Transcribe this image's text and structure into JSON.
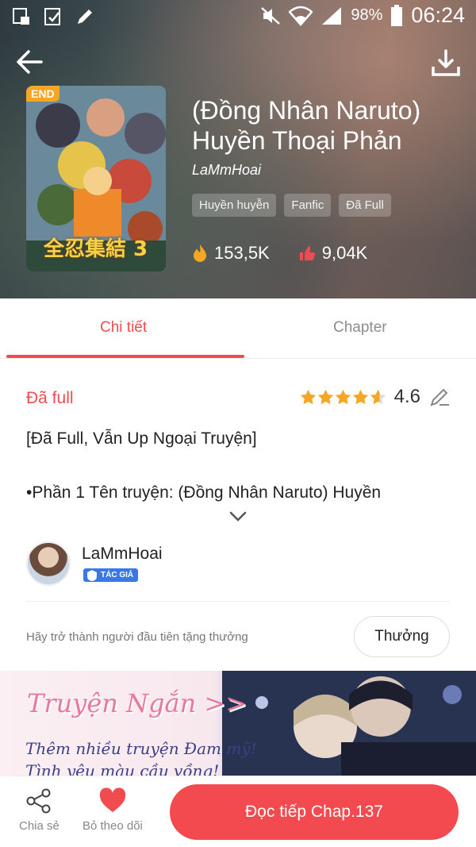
{
  "status_bar": {
    "battery": "98%",
    "time": "06:24"
  },
  "book": {
    "badge": "END",
    "cover_text": "全忍集結 3",
    "title": "(Đồng Nhân Naruto) Huyền Thoại Phản",
    "author": "LaMmHoai",
    "tags": [
      "Huyền huyễn",
      "Fanfic",
      "Đã Full"
    ],
    "views": "153,5K",
    "likes": "9,04K"
  },
  "tabs": {
    "detail": "Chi tiết",
    "chapter": "Chapter"
  },
  "details": {
    "status": "Đã full",
    "rating": "4.6",
    "stars": 4.6,
    "desc_line1": "[Đã Full, Vẫn Up Ngoại Truyện]",
    "desc_line2": "•Phần 1 Tên truyện: (Đồng Nhân Naruto) Huyền"
  },
  "author_block": {
    "name": "LaMmHoai",
    "badge": "TÁC GIẢ"
  },
  "gift": {
    "text": "Hãy trở thành người đầu tiên tặng thưởng",
    "button": "Thưởng"
  },
  "banner": {
    "title": "Truyện Ngắn >>",
    "sub1": "Thêm nhiều truyện Đam mỹ!",
    "sub2": "Tình yêu màu cầu vồng!"
  },
  "bottom": {
    "share": "Chia sẻ",
    "unfollow": "Bỏ theo dõi",
    "read": "Đọc tiếp Chap.137"
  },
  "colors": {
    "accent": "#f04b4f",
    "star": "#f5a623",
    "badge_blue": "#3b78e7"
  }
}
